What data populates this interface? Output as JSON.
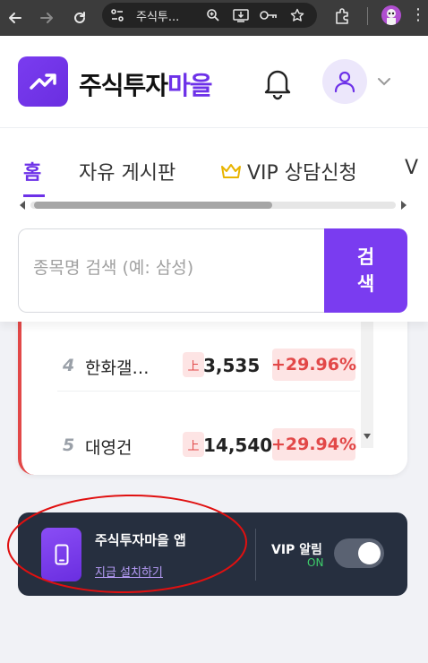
{
  "browser": {
    "url_text": "주식투...",
    "icons": {
      "back": "arrow-left-icon",
      "forward": "arrow-right-icon",
      "reload": "reload-icon",
      "site_info": "tune-icon",
      "zoom": "zoom-icon",
      "install": "install-app-icon",
      "password": "key-icon",
      "bookmark": "star-icon",
      "extensions": "puzzle-icon",
      "profile": "profile-avatar",
      "menu": "kebab-menu-icon"
    },
    "colors": {
      "chrome_bg": "#3c3c3c",
      "omnibox_bg": "#232323"
    }
  },
  "header": {
    "brand_main": "주식투자",
    "brand_accent": "마을",
    "icons": {
      "logo": "trend-up-icon",
      "bell": "bell-icon",
      "user": "user-icon",
      "chevron": "chevron-down-icon"
    },
    "colors": {
      "accent": "#6d31e8"
    }
  },
  "nav": {
    "tabs": [
      {
        "label": "홈",
        "active": true
      },
      {
        "label": "자유 게시판",
        "active": false
      },
      {
        "label": "VIP 상담신청",
        "active": false,
        "icon": "crown-icon"
      },
      {
        "label": "V",
        "active": false
      }
    ]
  },
  "search": {
    "placeholder": "종목명 검색 (예: 삼성)",
    "button_line1": "검",
    "button_line2": "색"
  },
  "ranking": {
    "rows": [
      {
        "rank": "4",
        "name": "한화갤…",
        "arrow": "上",
        "price": "3,535",
        "change": "+29.96%"
      },
      {
        "rank": "5",
        "name": "대영건",
        "arrow": "上",
        "price": "14,540",
        "change": "+29.94%"
      }
    ],
    "colors": {
      "up": "#e24848",
      "up_bg": "#fde4e4"
    }
  },
  "banner": {
    "app_title": "주식투자마을 앱",
    "install_link": "지금 설치하기",
    "vip_alert_label": "VIP 알림",
    "vip_alert_state": "ON",
    "toggle_on": true,
    "icons": {
      "app": "smartphone-icon"
    },
    "colors": {
      "bg": "#262f3f",
      "on": "#3ecf6b",
      "link": "#b69cf7"
    }
  },
  "annotation": {
    "color": "#e01010"
  }
}
